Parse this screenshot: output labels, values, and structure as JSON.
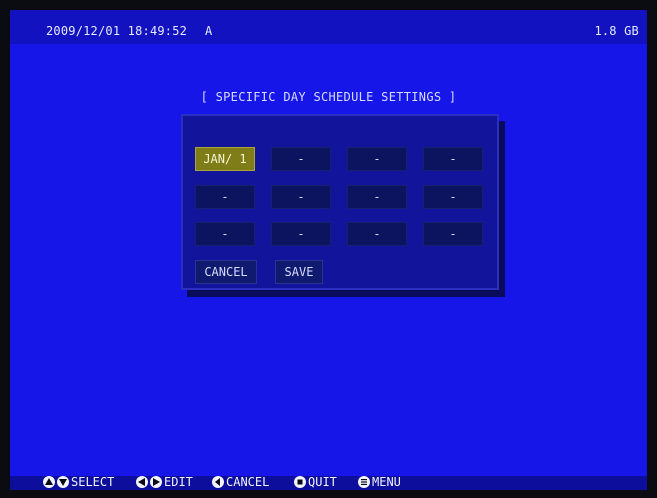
{
  "status": {
    "datetime": "2009/12/01 18:49:52",
    "mode": "A",
    "hdd": "1.8 GB"
  },
  "dialog": {
    "title": "[ SPECIFIC DAY SCHEDULE SETTINGS ]",
    "days": [
      "JAN/ 1",
      "-",
      "-",
      "-",
      "-",
      "-",
      "-",
      "-",
      "-",
      "-",
      "-",
      "-"
    ],
    "buttons": {
      "cancel": "CANCEL",
      "save": "SAVE"
    }
  },
  "footer": {
    "select": "SELECT",
    "edit": "EDIT",
    "cancel": "CANCEL",
    "quit": "QUIT",
    "menu": "MENU"
  },
  "colors": {
    "screen": "#1616e8",
    "dialog": "#12149b",
    "cell": "#0c1460",
    "active_cell": "#7f7d18"
  },
  "icons": {
    "select": [
      "up-arrow-icon",
      "down-arrow-icon"
    ],
    "edit": [
      "left-arrow-icon",
      "right-arrow-icon"
    ],
    "cancel": "back-arrow-icon",
    "quit": "stop-icon",
    "menu": "menu-icon"
  }
}
